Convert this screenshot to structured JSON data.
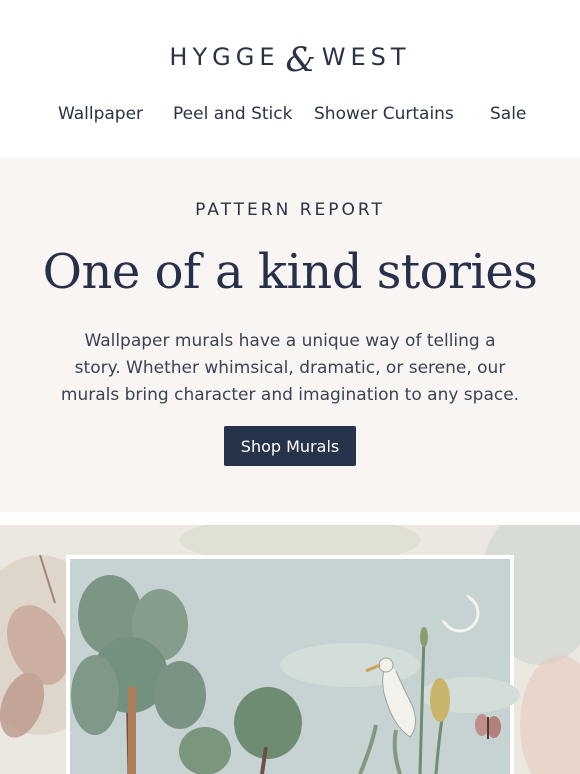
{
  "brand": {
    "name_left": "HYGGE",
    "ampersand": "&",
    "name_right": "WEST"
  },
  "nav": {
    "items": [
      {
        "label": "Wallpaper"
      },
      {
        "label": "Peel and Stick"
      },
      {
        "label": "Shower Curtains"
      },
      {
        "label": "Sale"
      }
    ]
  },
  "hero": {
    "eyebrow": "PATTERN REPORT",
    "headline": "One of a kind stories",
    "body": "Wallpaper murals have a unique way of telling a story. Whether whimsical, dramatic, or serene, our murals bring character and imagination to any space.",
    "cta_label": "Shop Murals"
  },
  "colors": {
    "navy": "#27334a",
    "hero_bg": "#f9f5f2",
    "mural_sky": "#c9d5d3"
  }
}
